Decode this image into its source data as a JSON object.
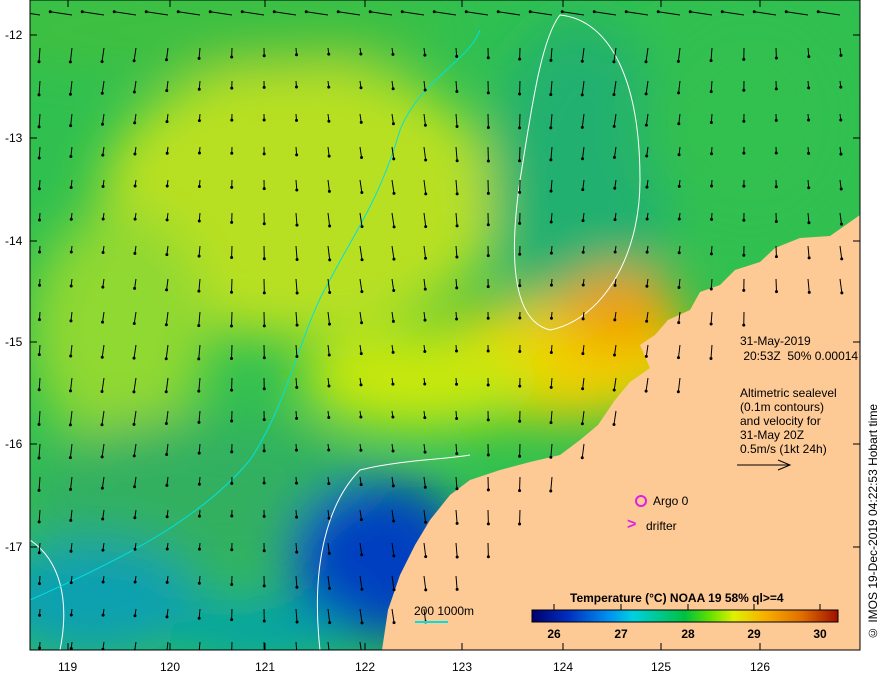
{
  "map": {
    "lon_ticks": [
      "119",
      "120",
      "121",
      "122",
      "123",
      "124",
      "125",
      "126"
    ],
    "lat_ticks": [
      "-12",
      "-13",
      "-14",
      "-15",
      "-16",
      "-17"
    ]
  },
  "info": {
    "date": "31-May-2019",
    "time_line": " 20:53Z  50% 0.00014",
    "altimetry": "Altimetric sealevel\n(0.1m contours)\nand velocity for\n31-May 20Z\n0.5m/s (1kt 24h)"
  },
  "legend": {
    "argo": "Argo 0",
    "drifter": "drifter",
    "drifter_symbol": ">",
    "bathy": "200  1000m"
  },
  "colorbar": {
    "title": "Temperature (°C) NOAA 19 58% ql>=4",
    "ticks": [
      "26",
      "27",
      "28",
      "29",
      "30"
    ]
  },
  "credit": "© IMOS 19-Dec-2019 04:22:53 Hobart time",
  "colors": {
    "land": "#fdc994",
    "argo": "#e020e0",
    "bathy": "#00e0e0"
  }
}
